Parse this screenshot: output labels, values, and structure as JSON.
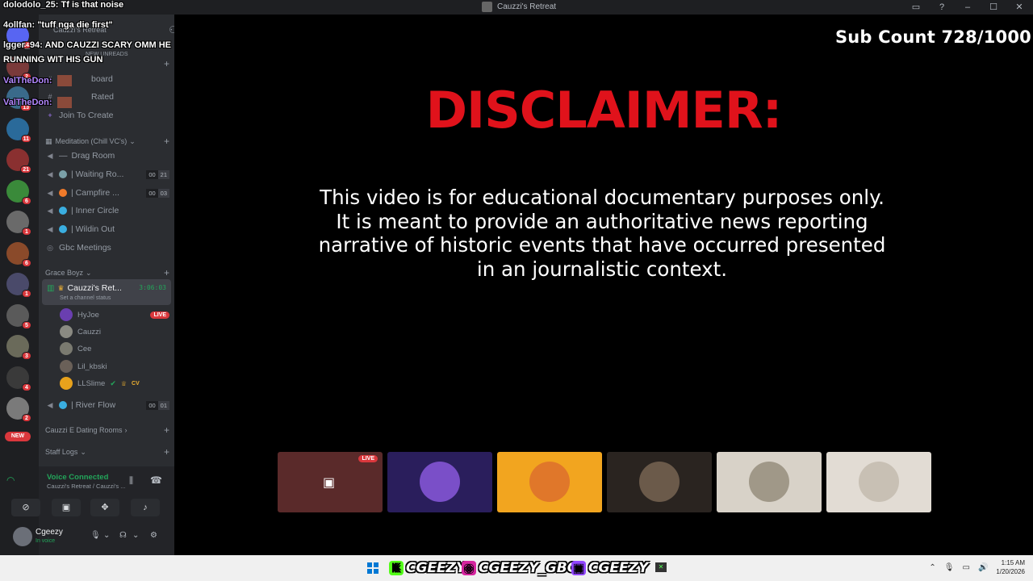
{
  "window": {
    "title": "Cauzzi's Retreat"
  },
  "chat": [
    {
      "user": "dolodolo_25:",
      "message": "Tf is that noise",
      "color": "#ffffff"
    },
    {
      "user": "4ollfan:",
      "message": "\"tuff nga die first\"",
      "color": "#ffffff"
    },
    {
      "user": "lgger_94:",
      "message": "AND CAUZZI SCARY OMM HE",
      "message2": "RUNNING WIT HIS GUN",
      "color": "#ffffff"
    },
    {
      "user": "ValTheDon:",
      "message": "",
      "color": "#b388ff"
    },
    {
      "user": "ValTheDon:",
      "message": "",
      "color": "#b388ff"
    }
  ],
  "sidebar": {
    "server_name": "Cauzzi's Retreat",
    "new_unreads": "NEW UNREADS",
    "channels_top": [
      {
        "label": "board"
      },
      {
        "label": "Rated"
      },
      {
        "label": "Join To Create"
      }
    ],
    "categories": {
      "meditation": "Meditation (Chill VC's)",
      "grace_boyz": "Grace Boyz",
      "dating_rooms": "Cauzzi E Dating Rooms",
      "staff_logs": "Staff Logs"
    },
    "meditation_channels": [
      {
        "label": "Drag Room"
      },
      {
        "label": "| Waiting Ro...",
        "pill1": "00",
        "pill2": "21"
      },
      {
        "label": "| Campfire ...",
        "pill1": "00",
        "pill2": "03"
      },
      {
        "label": "| Inner Circle"
      },
      {
        "label": "| Wildin Out"
      },
      {
        "label": "Gbc Meetings"
      }
    ],
    "active_channel": {
      "name": "Cauzzi's Ret...",
      "timer": "3:06:03",
      "status": "Set a channel status"
    },
    "voice_users": [
      {
        "name": "HyJoe",
        "live": "LIVE"
      },
      {
        "name": "Cauzzi"
      },
      {
        "name": "Cee"
      },
      {
        "name": "Lil_kbski"
      },
      {
        "name": "LLSlime",
        "tag": "CV"
      }
    ],
    "river_flow": {
      "label": "| River Flow",
      "pill1": "00",
      "pill2": "01"
    }
  },
  "server_badges": [
    "24",
    "2",
    "13",
    "11",
    "21",
    "6",
    "1",
    "6",
    "1",
    "5",
    "3",
    "4",
    "2",
    "NEW"
  ],
  "voice_panel": {
    "status": "Voice Connected",
    "sub": "Cauzzi's Retreat / Cauzzi's ...",
    "username": "Cgeezy",
    "user_status": "In voice"
  },
  "stage": {
    "sub_count": "Sub Count 728/1000",
    "disclaimer_title": "DISCLAIMER:",
    "disclaimer_lines": [
      "This video is for educational documentary purposes only.",
      "It is meant to provide an authoritative news reporting",
      "narrative of historic events that have occurred presented",
      "in an journalistic context."
    ],
    "tile_live": "LIVE"
  },
  "tiles": [
    {
      "name": "stream-tile-hyjoe",
      "bg": "#5a2a2a",
      "live": true
    },
    {
      "name": "avatar-tile-purple",
      "bg": "#2a1e5c",
      "circle": "#7a4fc8"
    },
    {
      "name": "avatar-tile-discord",
      "bg": "#f2a51f",
      "circle": "#e0772a"
    },
    {
      "name": "avatar-tile-dark",
      "bg": "#2a2420",
      "circle": "#6b5a4a"
    },
    {
      "name": "avatar-tile-photo",
      "bg": "#d8d2c8",
      "circle": "#a09888"
    },
    {
      "name": "avatar-tile-light",
      "bg": "#e2dcd4",
      "circle": "#c8c0b4"
    }
  ],
  "taskbar": {
    "socials": [
      {
        "handle": "CGEEZY",
        "icon": "kick-icon",
        "color": "#53fc18",
        "glyph": "K"
      },
      {
        "handle": "CGEEZY_GBC",
        "icon": "instagram-icon",
        "color": "#d6249f",
        "glyph": "◎"
      },
      {
        "handle": "CGEEZY",
        "icon": "twitch-icon",
        "color": "#9146ff",
        "glyph": "▣"
      }
    ],
    "time": "1:15 AM",
    "date": "1/20/2026"
  }
}
